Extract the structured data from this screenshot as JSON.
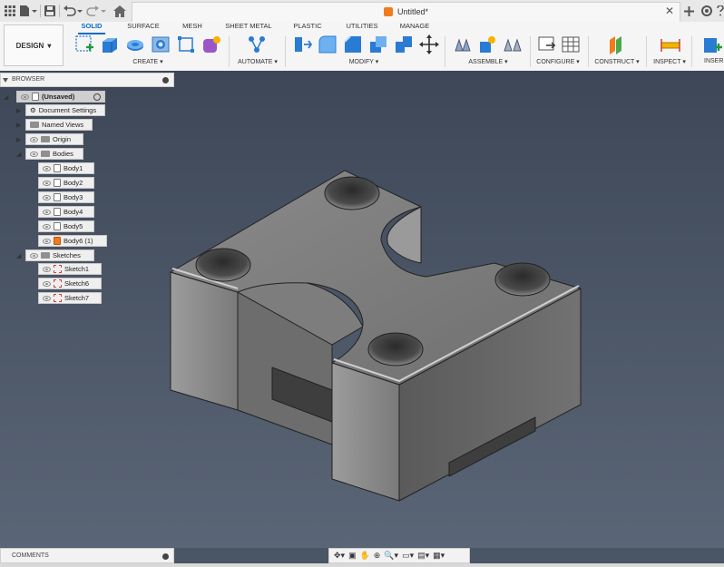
{
  "window": {
    "document_title": "Untitled*"
  },
  "ribbon": {
    "workspace": "DESIGN",
    "tabs": [
      "SOLID",
      "SURFACE",
      "MESH",
      "SHEET METAL",
      "PLASTIC",
      "UTILITIES",
      "MANAGE"
    ],
    "active_tab": "SOLID",
    "groups": [
      "CREATE ▾",
      "AUTOMATE ▾",
      "MODIFY ▾",
      "ASSEMBLE ▾",
      "CONFIGURE ▾",
      "CONSTRUCT ▾",
      "INSPECT ▾",
      "INSER"
    ]
  },
  "browser": {
    "title": "BROWSER",
    "root": "(Unsaved)",
    "items": {
      "document_settings": "Document Settings",
      "named_views": "Named Views",
      "origin": "Origin",
      "bodies": "Bodies",
      "body1": "Body1",
      "body2": "Body2",
      "body3": "Body3",
      "body4": "Body4",
      "body5": "Body5",
      "body6": "Body6 (1)",
      "sketches": "Sketches",
      "sketch1": "Sketch1",
      "sketch6": "Sketch6",
      "sketch7": "Sketch7"
    }
  },
  "comments": {
    "title": "COMMENTS"
  },
  "colors": {
    "accent": "#0a6bc5",
    "viewport": "#4a5565",
    "body_orange": "#f07b1d"
  }
}
